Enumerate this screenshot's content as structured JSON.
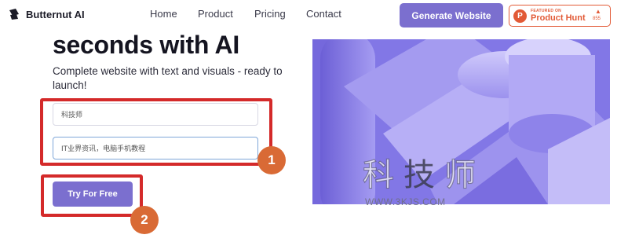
{
  "header": {
    "brand": "Butternut AI",
    "nav": [
      "Home",
      "Product",
      "Pricing",
      "Contact"
    ],
    "cta_label": "Generate Website",
    "product_hunt": {
      "featured_text": "FEATURED ON",
      "name": "Product Hunt",
      "logo_letter": "P",
      "upvote_arrow": "▲",
      "upvotes": "855"
    }
  },
  "hero": {
    "title": "seconds with AI",
    "subtitle": "Complete website with text and visuals - ready to launch!",
    "inputs": [
      {
        "value": "科技师"
      },
      {
        "value": "IT业界资讯，电脑手机教程"
      }
    ],
    "try_button": "Try For Free"
  },
  "annotations": {
    "badge_1": "1",
    "badge_2": "2"
  },
  "watermark": {
    "chars": [
      "科",
      "技",
      "师"
    ],
    "url": "WWW.3KJS.COM"
  },
  "colors": {
    "accent": "#7b6fcf",
    "product_hunt": "#e25a36",
    "callout": "#d42a2a",
    "badge": "#d96a35",
    "image_bg": "#8a7fe8"
  }
}
